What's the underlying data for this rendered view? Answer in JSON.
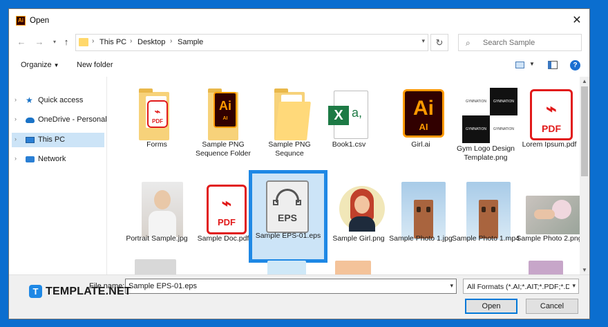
{
  "window": {
    "title": "Open",
    "app_icon": "Ai"
  },
  "address": {
    "crumbs": [
      "This PC",
      "Desktop",
      "Sample"
    ]
  },
  "search": {
    "placeholder": "Search Sample"
  },
  "toolbar": {
    "organize": "Organize",
    "new_folder": "New folder",
    "help": "?"
  },
  "sidebar": {
    "items": [
      {
        "label": "Quick access",
        "icon": "star-icon"
      },
      {
        "label": "OneDrive - Personal",
        "icon": "cloud-icon"
      },
      {
        "label": "This PC",
        "icon": "computer-icon",
        "selected": true
      },
      {
        "label": "Network",
        "icon": "network-icon"
      }
    ]
  },
  "files": [
    {
      "name": "Forms",
      "type": "folder-pdf"
    },
    {
      "name": "Sample PNG Sequence Folder",
      "type": "folder-ai"
    },
    {
      "name": "Sample PNG Sequnce",
      "type": "folder"
    },
    {
      "name": "Book1.csv",
      "type": "csv"
    },
    {
      "name": "Girl.ai",
      "type": "ai"
    },
    {
      "name": "Gym Logo Design Template.png",
      "type": "image"
    },
    {
      "name": "Lorem Ipsum.pdf",
      "type": "pdf"
    },
    {
      "name": "Portrait Sample.jpg",
      "type": "image"
    },
    {
      "name": "Sample Doc.pdf",
      "type": "pdf"
    },
    {
      "name": "Sample EPS-01.eps",
      "type": "eps",
      "selected": true
    },
    {
      "name": "Sample Girl.png",
      "type": "image"
    },
    {
      "name": "Sample Photo 1.jpg",
      "type": "image"
    },
    {
      "name": "Sample Photo 1.mp4",
      "type": "video"
    },
    {
      "name": "Sample Photo 2.png",
      "type": "image"
    }
  ],
  "icons": {
    "pdf_text": "PDF",
    "ai_text": "Ai",
    "ai_sub": "AI",
    "eps_text": "EPS",
    "csv_x": "X",
    "csv_a": "a,",
    "gym_text": "GYMNATION"
  },
  "footer": {
    "file_name_label": "File name:",
    "file_name_value": "Sample EPS-01.eps",
    "format_value": "All Formats (*.AI;*.AIT;*.PDF;*.D",
    "open_label": "Open",
    "cancel_label": "Cancel"
  },
  "watermark": {
    "mark": "T",
    "text": "TEMPLATE.NET"
  },
  "colors": {
    "accent": "#1e88e5",
    "pdf_red": "#e11a1a",
    "ai_orange": "#ff9a00",
    "folder": "#f7d27a"
  }
}
